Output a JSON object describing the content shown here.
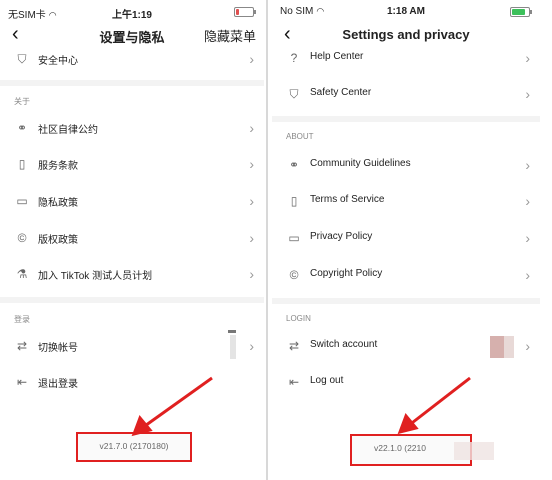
{
  "left": {
    "status": {
      "carrier": "无SIM卡",
      "wifi": "wifi-icon",
      "time": "上午1:19",
      "battery_color": "#e05050",
      "battery_level": 0.15
    },
    "title": "设置与隐私",
    "extra": "隐藏菜单",
    "rows_top": [
      {
        "label": "安全中心",
        "icon": "shield-icon"
      }
    ],
    "section_about": "关于",
    "rows_about": [
      {
        "label": "社区自律公约",
        "icon": "community-icon"
      },
      {
        "label": "服务条款",
        "icon": "book-icon"
      },
      {
        "label": "隐私政策",
        "icon": "document-icon"
      },
      {
        "label": "版权政策",
        "icon": "copyright-icon"
      },
      {
        "label": "加入 TikTok 测试人员计划",
        "icon": "flask-icon"
      }
    ],
    "section_login": "登录",
    "rows_login": [
      {
        "label": "切换帐号",
        "icon": "switch-icon"
      },
      {
        "label": "退出登录",
        "icon": "logout-icon"
      }
    ],
    "version": "v21.7.0 (2170180)"
  },
  "right": {
    "status": {
      "carrier": "No SIM",
      "wifi": "wifi-icon",
      "time": "1:18 AM",
      "battery_color": "#3cc05a",
      "battery_level": 0.8
    },
    "title": "Settings and privacy",
    "rows_top": [
      {
        "label": "Help Center",
        "icon": "help-icon"
      },
      {
        "label": "Safety Center",
        "icon": "shield-icon"
      }
    ],
    "section_about": "ABOUT",
    "rows_about": [
      {
        "label": "Community Guidelines",
        "icon": "community-icon"
      },
      {
        "label": "Terms of Service",
        "icon": "book-icon"
      },
      {
        "label": "Privacy Policy",
        "icon": "document-icon"
      },
      {
        "label": "Copyright Policy",
        "icon": "copyright-icon"
      }
    ],
    "section_login": "LOGIN",
    "rows_login": [
      {
        "label": "Switch account",
        "icon": "switch-icon"
      },
      {
        "label": "Log out",
        "icon": "logout-icon"
      }
    ],
    "version": "v22.1.0 (2210"
  },
  "accent": "#e02020"
}
